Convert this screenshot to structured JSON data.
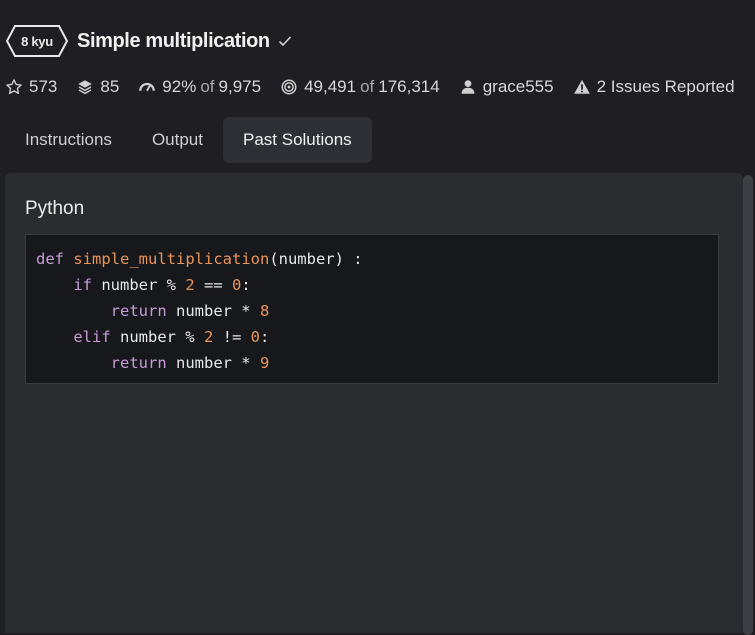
{
  "kata": {
    "rank": "8 kyu",
    "title": "Simple multiplication",
    "completed_icon": "checkmark-icon"
  },
  "stats": {
    "stars": "573",
    "collections": "85",
    "satisfaction": "92%",
    "satisfaction_of": "of",
    "votes": "9,975",
    "completions": "49,491",
    "completions_of": "of",
    "attempts": "176,314",
    "author": "grace555",
    "issues": "2 Issues Reported"
  },
  "tabs": [
    {
      "label": "Instructions",
      "active": false
    },
    {
      "label": "Output",
      "active": false
    },
    {
      "label": "Past Solutions",
      "active": true
    }
  ],
  "solution": {
    "language": "Python",
    "code_lines": [
      "def simple_multiplication(number) :",
      "    if number % 2 == 0:",
      "        return number * 8",
      "    elif number % 2 != 0:",
      "        return number * 9"
    ]
  },
  "colors": {
    "background": "#1f1f23",
    "panel": "#2b2c30",
    "code_bg": "#17181b",
    "keyword": "#c79cd8",
    "function_and_number": "#e9955a"
  }
}
